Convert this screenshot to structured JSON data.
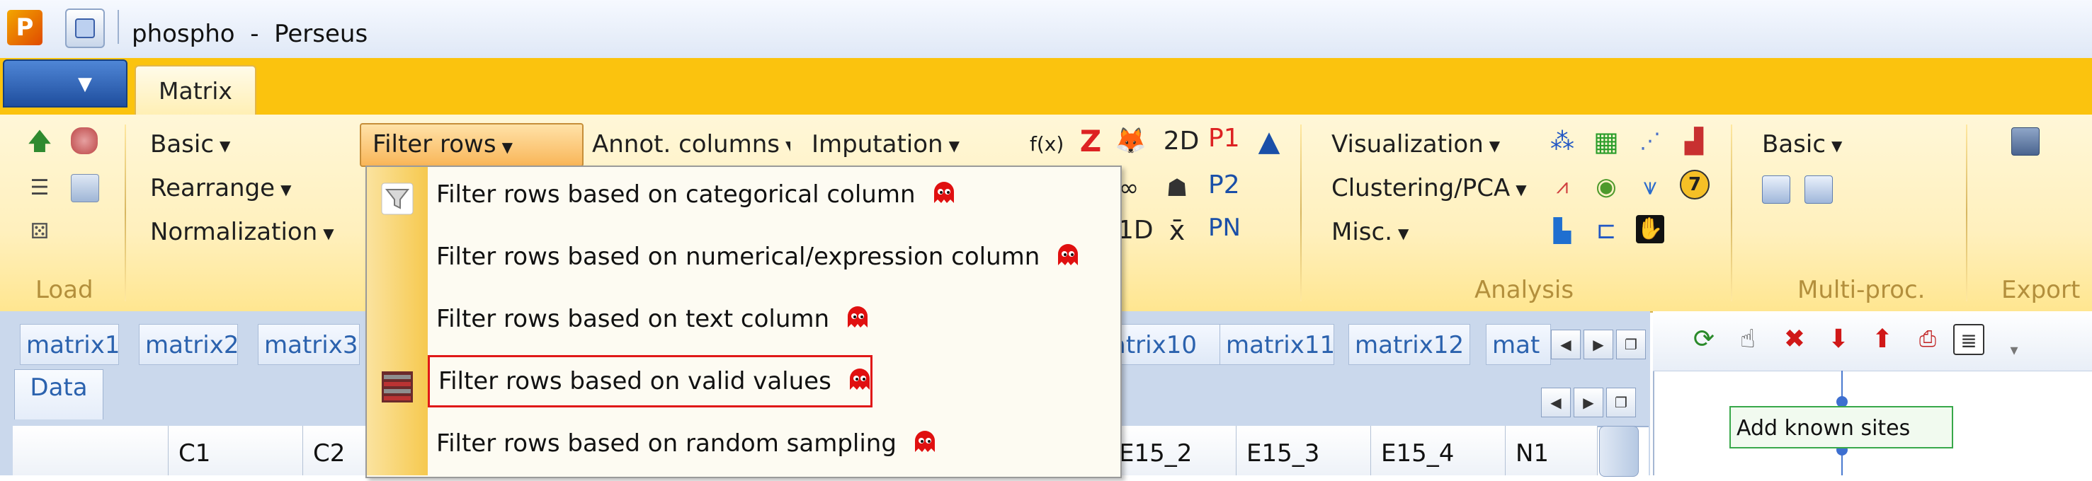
{
  "window": {
    "app_icon_letter": "P",
    "title": "phospho  -  Perseus"
  },
  "tabs": {
    "active_tab": "Matrix"
  },
  "ribbon": {
    "load": {
      "label": "Load"
    },
    "processing": {
      "basic": "Basic",
      "rearrange": "Rearrange",
      "normalization": "Normalization",
      "filter_rows": "Filter rows",
      "annot_columns": "Annot. columns",
      "imputation": "Imputation"
    },
    "analysis": {
      "visualization": "Visualization",
      "clustering_pca": "Clustering/PCA",
      "misc": "Misc.",
      "label": "Analysis",
      "icons": [
        "f(x)",
        "Z",
        "2D",
        "P1",
        "P2",
        "PN",
        "1D",
        "x̄"
      ]
    },
    "multi_proc": {
      "basic": "Basic",
      "label": "Multi-proc."
    },
    "export": {
      "label": "Export"
    }
  },
  "dropdown": {
    "items": [
      {
        "label": "Filter rows based on categorical column"
      },
      {
        "label": "Filter rows based on numerical/expression column"
      },
      {
        "label": "Filter rows based on text column"
      },
      {
        "label": "Filter rows based on valid values"
      },
      {
        "label": "Filter rows based on random sampling"
      }
    ],
    "highlighted_index": 3
  },
  "matrix_tabs": [
    "matrix1",
    "matrix2",
    "matrix3",
    "atrix10",
    "matrix11",
    "matrix12",
    "mat"
  ],
  "data_panel": {
    "tab_label": "Data",
    "columns": [
      "",
      "C1",
      "C2",
      "E15_2",
      "E15_3",
      "E15_4",
      "N1"
    ]
  },
  "workflow": {
    "node_label": "Add known sites"
  },
  "colors": {
    "ribbon_tab_bg": "#fbc30e",
    "highlight_border": "#e01818",
    "link_blue": "#2b62ae"
  }
}
